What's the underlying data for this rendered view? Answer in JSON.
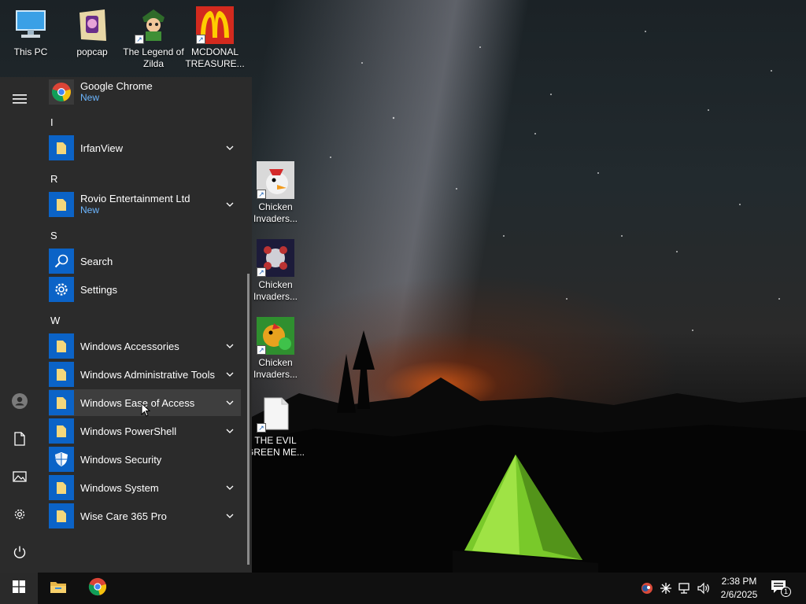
{
  "desktop": {
    "icons_top": [
      {
        "label": "This PC",
        "icon": "this-pc-icon"
      },
      {
        "label": "popcap",
        "icon": "popcap-icon"
      },
      {
        "label": "The Legend of Zilda",
        "icon": "zilda-game-icon"
      },
      {
        "label": "MCDONAL TREASURE...",
        "icon": "mcdonald-icon"
      }
    ],
    "icons_col": [
      {
        "label": "Chicken Invaders...",
        "icon": "chicken-invaders-icon"
      },
      {
        "label": "Chicken Invaders...",
        "icon": "chicken-invaders-icon"
      },
      {
        "label": "Chicken Invaders...",
        "icon": "chicken-invaders-icon"
      },
      {
        "label": "THE EVIL GREEN ME...",
        "icon": "document-icon"
      }
    ]
  },
  "start_menu": {
    "groups": [
      {
        "letter": "I"
      },
      {
        "letter": "R"
      },
      {
        "letter": "S"
      },
      {
        "letter": "W"
      }
    ],
    "apps": [
      {
        "name": "Google Chrome",
        "badge": "New",
        "icon": "chrome-icon"
      },
      {
        "name": "IrfanView",
        "icon": "folder-icon"
      },
      {
        "name": "Rovio Entertainment Ltd",
        "badge": "New",
        "icon": "folder-icon"
      },
      {
        "name": "Search",
        "icon": "search-icon"
      },
      {
        "name": "Settings",
        "icon": "gear-icon"
      },
      {
        "name": "Windows Accessories",
        "icon": "folder-icon"
      },
      {
        "name": "Windows Administrative Tools",
        "icon": "folder-icon"
      },
      {
        "name": "Windows Ease of Access",
        "icon": "folder-icon"
      },
      {
        "name": "Windows PowerShell",
        "icon": "folder-icon"
      },
      {
        "name": "Windows Security",
        "icon": "shield-icon"
      },
      {
        "name": "Windows System",
        "icon": "folder-icon"
      },
      {
        "name": "Wise Care 365 Pro",
        "icon": "folder-icon"
      }
    ]
  },
  "taskbar": {
    "time": "2:38 PM",
    "date": "2/6/2025",
    "notification_count": "1"
  },
  "colors": {
    "accent": "#0b63c7",
    "new_badge": "#6cb6ff",
    "menu_bg": "#2b2b2b",
    "taskbar_bg": "#101010"
  }
}
